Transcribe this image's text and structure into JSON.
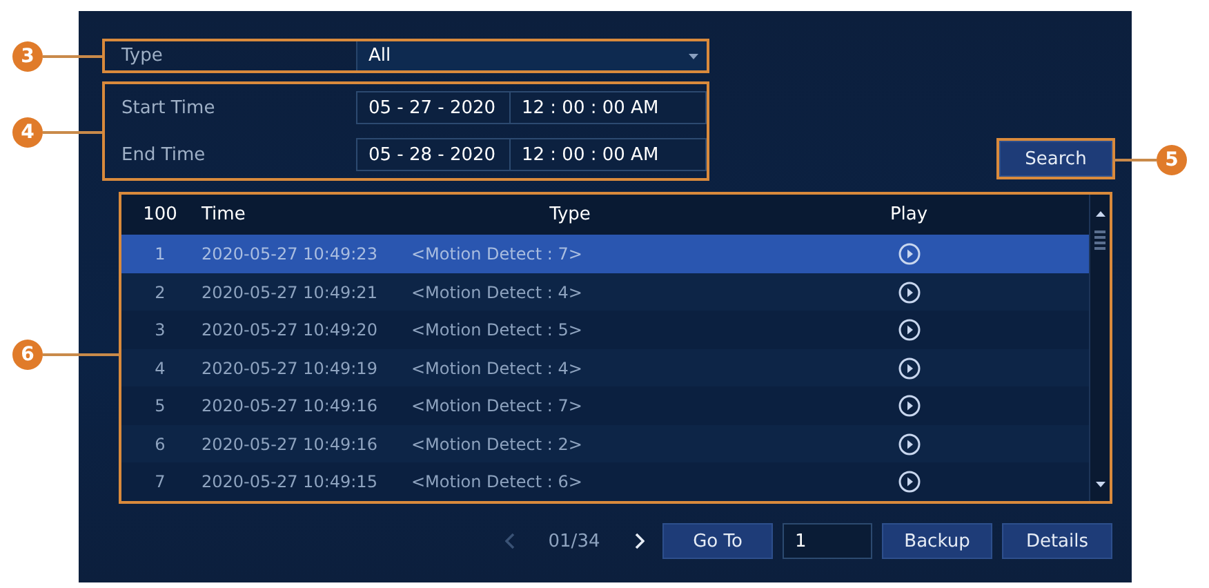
{
  "filters": {
    "type": {
      "label": "Type",
      "value": "All"
    },
    "times": [
      {
        "label": "Start Time",
        "date": "05 - 27 - 2020",
        "time": "12 : 00 : 00 AM"
      },
      {
        "label": "End Time",
        "date": "05 - 28 - 2020",
        "time": "12 : 00 : 00 AM"
      }
    ]
  },
  "search_button": "Search",
  "table": {
    "columns": [
      "100",
      "Time",
      "Type",
      "Play"
    ],
    "rows": [
      {
        "index": "1",
        "time": "2020-05-27 10:49:23",
        "type": "<Motion Detect : 7>",
        "selected": true
      },
      {
        "index": "2",
        "time": "2020-05-27 10:49:21",
        "type": "<Motion Detect : 4>",
        "selected": false
      },
      {
        "index": "3",
        "time": "2020-05-27 10:49:20",
        "type": "<Motion Detect : 5>",
        "selected": false
      },
      {
        "index": "4",
        "time": "2020-05-27 10:49:19",
        "type": "<Motion Detect : 4>",
        "selected": false
      },
      {
        "index": "5",
        "time": "2020-05-27 10:49:16",
        "type": "<Motion Detect : 7>",
        "selected": false
      },
      {
        "index": "6",
        "time": "2020-05-27 10:49:16",
        "type": "<Motion Detect : 2>",
        "selected": false
      },
      {
        "index": "7",
        "time": "2020-05-27 10:49:15",
        "type": "<Motion Detect : 6>",
        "selected": false
      }
    ]
  },
  "pagination": {
    "prev_disabled": true,
    "page": "01/34",
    "next_disabled": false
  },
  "goto": {
    "button": "Go To",
    "value": "1"
  },
  "buttons": [
    "Backup",
    "Details"
  ],
  "callouts": [
    {
      "number": "3",
      "kind": "type"
    },
    {
      "number": "4",
      "kind": "time"
    },
    {
      "number": "5",
      "kind": "search"
    },
    {
      "number": "6",
      "kind": "table"
    }
  ]
}
